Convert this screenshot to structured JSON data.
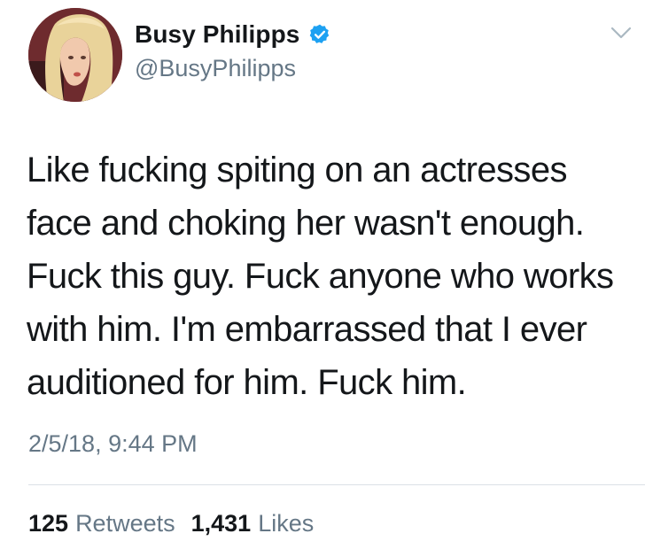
{
  "author": {
    "display_name": "Busy Philipps",
    "handle": "@BusyPhilipps",
    "verified": true
  },
  "tweet": {
    "lines": [
      "Like fucking spiting on an actresses",
      "face and choking her wasn't enough.",
      "Fuck this guy. Fuck anyone who works",
      "with him. I'm embarrassed that I ever",
      "auditioned for him. Fuck him."
    ],
    "timestamp": "2/5/18, 9:44 PM"
  },
  "stats": {
    "retweets_count": "125",
    "retweets_label": "Retweets",
    "likes_count": "1,431",
    "likes_label": "Likes"
  },
  "icons": {
    "verified": "verified-badge-icon",
    "menu": "chevron-down-icon"
  },
  "colors": {
    "verified_blue": "#1da1f2",
    "secondary_text": "#657786",
    "primary_text": "#14171a",
    "divider": "#dbe1e6"
  }
}
